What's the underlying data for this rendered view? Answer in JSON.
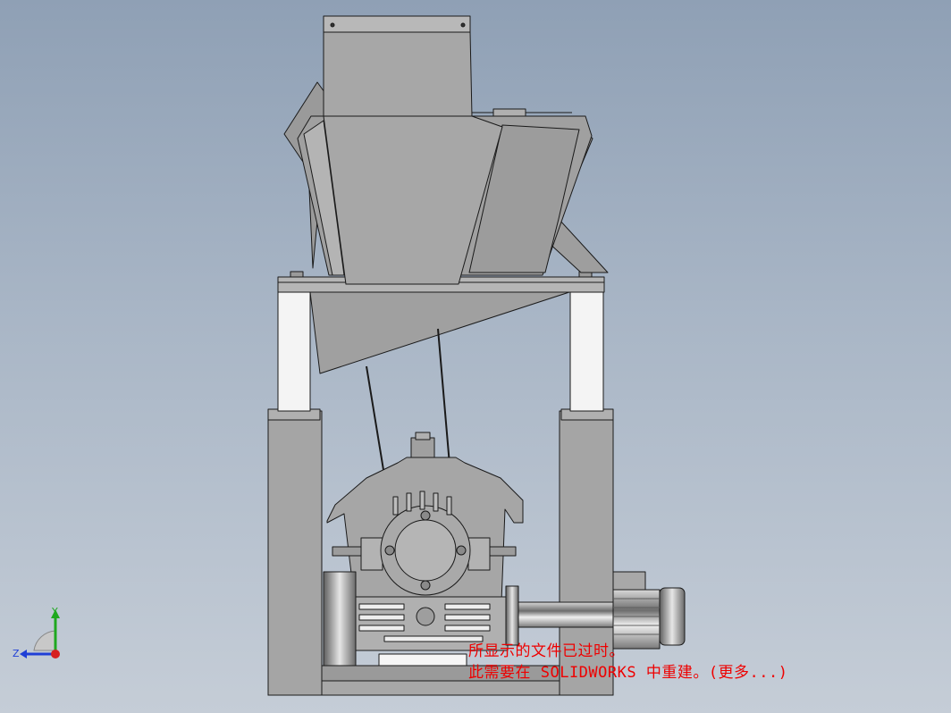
{
  "notice": {
    "line1": "所显示的文件已过时。",
    "line2": "此需要在 SOLIDWORKS 中重建。(更多...)"
  },
  "triad": {
    "y_label": "Y",
    "z_label": "Z",
    "y_color": "#1fa81f",
    "z_color": "#1f3fd6",
    "origin_color": "#d61f1f"
  },
  "colors": {
    "background_top": "#8fa0b5",
    "part_fill": "#a3a3a3",
    "part_dark": "#8c8c8c",
    "outline": "#1a1a1a"
  }
}
